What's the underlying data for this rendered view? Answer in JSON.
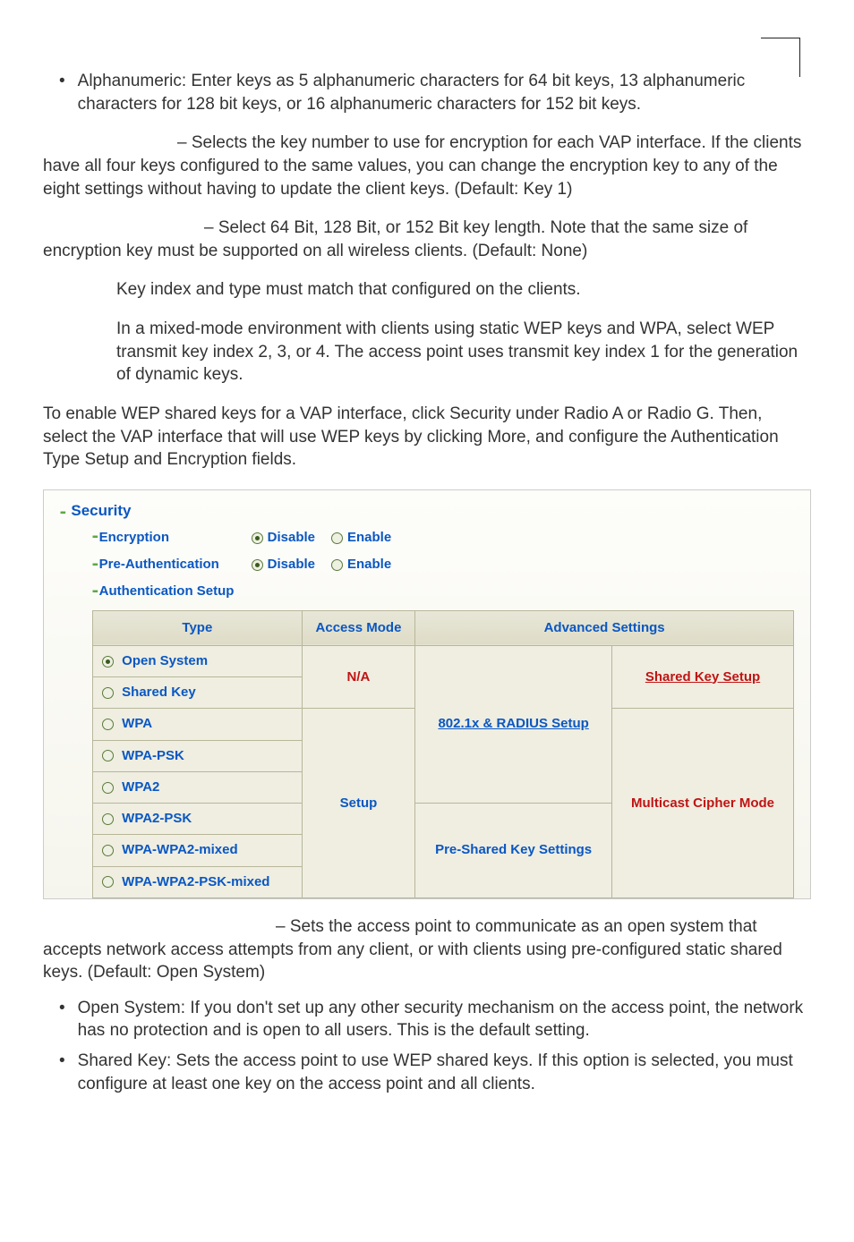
{
  "bullet1": "Alphanumeric: Enter keys as 5 alphanumeric characters for 64 bit keys, 13 alphanumeric characters for 128 bit keys, or 16 alphanumeric characters for 152 bit keys.",
  "para_key_number": "– Selects the key number to use for encryption for each VAP interface. If the clients have all four keys configured to the same values, you can change the encryption key to any of the eight settings without having to update the client keys. (Default: Key 1)",
  "para_key_length": "– Select 64 Bit, 128 Bit, or 152 Bit key length. Note that the same size of encryption key must be supported on all wireless clients. (Default: None)",
  "para_key_match": "Key index and type must match that configured on the clients.",
  "para_mixed": "In a mixed-mode environment with clients using static WEP keys and WPA, select WEP transmit key index 2, 3, or 4. The access point uses transmit key index 1 for the generation of dynamic keys.",
  "para_enable": "To enable WEP shared keys for a VAP interface, click Security under Radio A or Radio G. Then, select the VAP interface that will use WEP keys by clicking More, and configure the Authentication Type Setup and Encryption fields.",
  "screenshot": {
    "security": "Security",
    "encryption_label": "Encryption",
    "preauth_label": "Pre-Authentication",
    "auth_setup_label": "Authentication Setup",
    "disable": "Disable",
    "enable": "Enable",
    "th_type": "Type",
    "th_access": "Access Mode",
    "th_adv": "Advanced Settings",
    "types": {
      "open": "Open System",
      "shared": "Shared Key",
      "wpa": "WPA",
      "wpapsk": "WPA-PSK",
      "wpa2": "WPA2",
      "wpa2psk": "WPA2-PSK",
      "wpawpa2": "WPA-WPA2-mixed",
      "wpawpa2psk": "WPA-WPA2-PSK-mixed"
    },
    "na": "N/A",
    "setup": "Setup",
    "shared_key_setup": "Shared Key Setup",
    "radius_setup": "802.1x & RADIUS Setup",
    "psk_settings": "Pre-Shared Key Settings",
    "multicast": "Multicast Cipher Mode"
  },
  "para_after_shot": "– Sets the access point to communicate as an open system that accepts network access attempts from any client, or with clients using pre-configured static shared keys. (Default: Open System)",
  "bullet2a": "Open System: If you don't set up any other security mechanism on the access point, the network has no protection and is open to all users. This is the default setting.",
  "bullet2b": "Shared Key: Sets the access point to use WEP shared keys. If this option is selected, you must configure at least one key on the access point and all clients."
}
